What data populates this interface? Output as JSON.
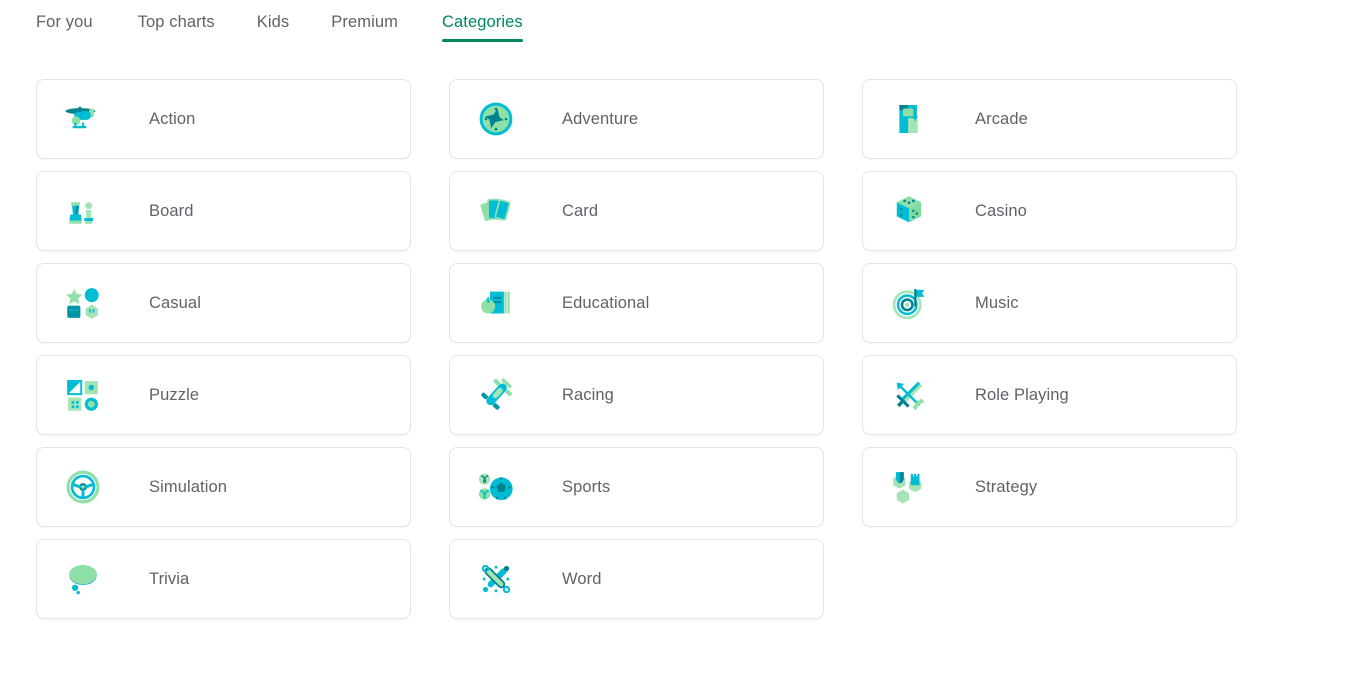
{
  "tabs": [
    {
      "label": "For you",
      "active": false
    },
    {
      "label": "Top charts",
      "active": false
    },
    {
      "label": "Kids",
      "active": false
    },
    {
      "label": "Premium",
      "active": false
    },
    {
      "label": "Categories",
      "active": true
    }
  ],
  "colors": {
    "accent": "#01875f",
    "text": "#5f6368",
    "card_border": "#e3e5e8",
    "icon_cyan": "#00bcd4",
    "icon_teal": "#00838f",
    "icon_green": "#a5e1a5",
    "background": "#ffffff"
  },
  "categories": [
    {
      "label": "Action",
      "icon": "helicopter-icon"
    },
    {
      "label": "Adventure",
      "icon": "compass-icon"
    },
    {
      "label": "Arcade",
      "icon": "arcade-cabinet-icon"
    },
    {
      "label": "Board",
      "icon": "chess-pieces-icon"
    },
    {
      "label": "Card",
      "icon": "playing-cards-icon"
    },
    {
      "label": "Casino",
      "icon": "dice-icon"
    },
    {
      "label": "Casual",
      "icon": "shapes-icon"
    },
    {
      "label": "Educational",
      "icon": "books-apple-icon"
    },
    {
      "label": "Music",
      "icon": "music-note-spiral-icon"
    },
    {
      "label": "Puzzle",
      "icon": "puzzle-tiles-icon"
    },
    {
      "label": "Racing",
      "icon": "race-car-icon"
    },
    {
      "label": "Role Playing",
      "icon": "sword-arrow-icon"
    },
    {
      "label": "Simulation",
      "icon": "steering-wheel-icon"
    },
    {
      "label": "Sports",
      "icon": "sports-balls-icon"
    },
    {
      "label": "Strategy",
      "icon": "shield-hex-icon"
    },
    {
      "label": "Trivia",
      "icon": "thought-bubble-icon"
    },
    {
      "label": "Word",
      "icon": "crossed-pencils-icon"
    }
  ]
}
